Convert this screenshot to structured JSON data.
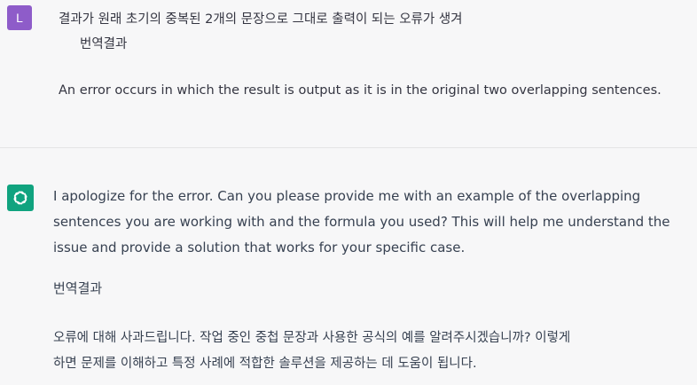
{
  "user_message": {
    "avatar_letter": "L",
    "original_text": "결과가 원래 초기의 중복된 2개의 문장으로 그대로 출력이 되는 오류가 생겨",
    "translation_label": "번역결과",
    "translated_text": "An error occurs in which the result is output as it is in the original two overlapping sentences."
  },
  "assistant_message": {
    "avatar_icon": "openai-logo-icon",
    "reply_lines": [
      "I apologize for the error. Can you please provide me with an example of the overlapping",
      "sentences you are working with and the formula you used? This will help me understand the",
      "issue and provide a solution that works for your specific case."
    ],
    "translation_label": "번역결과",
    "translated_lines": [
      "오류에 대해 사과드립니다. 작업 중인 중첩 문장과 사용한 공식의 예를 알려주시겠습니까? 이렇게",
      "하면 문제를 이해하고 특정 사례에 적합한 솔루션을 제공하는 데 도움이 됩니다."
    ]
  },
  "colors": {
    "user_avatar": "#8e5cc9",
    "assistant_avatar": "#10a37f",
    "background": "#f7f7f8",
    "text": "#374151"
  }
}
